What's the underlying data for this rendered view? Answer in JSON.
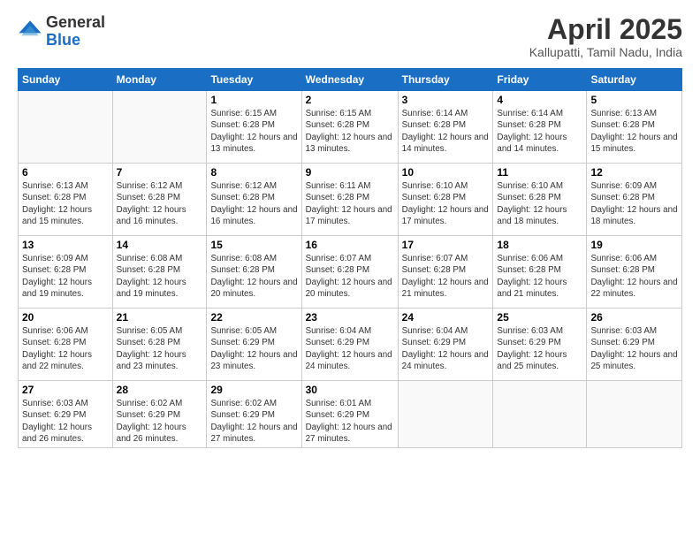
{
  "header": {
    "logo_general": "General",
    "logo_blue": "Blue",
    "month_title": "April 2025",
    "location": "Kallupatti, Tamil Nadu, India"
  },
  "days_of_week": [
    "Sunday",
    "Monday",
    "Tuesday",
    "Wednesday",
    "Thursday",
    "Friday",
    "Saturday"
  ],
  "weeks": [
    [
      {
        "num": "",
        "sunrise": "",
        "sunset": "",
        "daylight": ""
      },
      {
        "num": "",
        "sunrise": "",
        "sunset": "",
        "daylight": ""
      },
      {
        "num": "1",
        "sunrise": "Sunrise: 6:15 AM",
        "sunset": "Sunset: 6:28 PM",
        "daylight": "Daylight: 12 hours and 13 minutes."
      },
      {
        "num": "2",
        "sunrise": "Sunrise: 6:15 AM",
        "sunset": "Sunset: 6:28 PM",
        "daylight": "Daylight: 12 hours and 13 minutes."
      },
      {
        "num": "3",
        "sunrise": "Sunrise: 6:14 AM",
        "sunset": "Sunset: 6:28 PM",
        "daylight": "Daylight: 12 hours and 14 minutes."
      },
      {
        "num": "4",
        "sunrise": "Sunrise: 6:14 AM",
        "sunset": "Sunset: 6:28 PM",
        "daylight": "Daylight: 12 hours and 14 minutes."
      },
      {
        "num": "5",
        "sunrise": "Sunrise: 6:13 AM",
        "sunset": "Sunset: 6:28 PM",
        "daylight": "Daylight: 12 hours and 15 minutes."
      }
    ],
    [
      {
        "num": "6",
        "sunrise": "Sunrise: 6:13 AM",
        "sunset": "Sunset: 6:28 PM",
        "daylight": "Daylight: 12 hours and 15 minutes."
      },
      {
        "num": "7",
        "sunrise": "Sunrise: 6:12 AM",
        "sunset": "Sunset: 6:28 PM",
        "daylight": "Daylight: 12 hours and 16 minutes."
      },
      {
        "num": "8",
        "sunrise": "Sunrise: 6:12 AM",
        "sunset": "Sunset: 6:28 PM",
        "daylight": "Daylight: 12 hours and 16 minutes."
      },
      {
        "num": "9",
        "sunrise": "Sunrise: 6:11 AM",
        "sunset": "Sunset: 6:28 PM",
        "daylight": "Daylight: 12 hours and 17 minutes."
      },
      {
        "num": "10",
        "sunrise": "Sunrise: 6:10 AM",
        "sunset": "Sunset: 6:28 PM",
        "daylight": "Daylight: 12 hours and 17 minutes."
      },
      {
        "num": "11",
        "sunrise": "Sunrise: 6:10 AM",
        "sunset": "Sunset: 6:28 PM",
        "daylight": "Daylight: 12 hours and 18 minutes."
      },
      {
        "num": "12",
        "sunrise": "Sunrise: 6:09 AM",
        "sunset": "Sunset: 6:28 PM",
        "daylight": "Daylight: 12 hours and 18 minutes."
      }
    ],
    [
      {
        "num": "13",
        "sunrise": "Sunrise: 6:09 AM",
        "sunset": "Sunset: 6:28 PM",
        "daylight": "Daylight: 12 hours and 19 minutes."
      },
      {
        "num": "14",
        "sunrise": "Sunrise: 6:08 AM",
        "sunset": "Sunset: 6:28 PM",
        "daylight": "Daylight: 12 hours and 19 minutes."
      },
      {
        "num": "15",
        "sunrise": "Sunrise: 6:08 AM",
        "sunset": "Sunset: 6:28 PM",
        "daylight": "Daylight: 12 hours and 20 minutes."
      },
      {
        "num": "16",
        "sunrise": "Sunrise: 6:07 AM",
        "sunset": "Sunset: 6:28 PM",
        "daylight": "Daylight: 12 hours and 20 minutes."
      },
      {
        "num": "17",
        "sunrise": "Sunrise: 6:07 AM",
        "sunset": "Sunset: 6:28 PM",
        "daylight": "Daylight: 12 hours and 21 minutes."
      },
      {
        "num": "18",
        "sunrise": "Sunrise: 6:06 AM",
        "sunset": "Sunset: 6:28 PM",
        "daylight": "Daylight: 12 hours and 21 minutes."
      },
      {
        "num": "19",
        "sunrise": "Sunrise: 6:06 AM",
        "sunset": "Sunset: 6:28 PM",
        "daylight": "Daylight: 12 hours and 22 minutes."
      }
    ],
    [
      {
        "num": "20",
        "sunrise": "Sunrise: 6:06 AM",
        "sunset": "Sunset: 6:28 PM",
        "daylight": "Daylight: 12 hours and 22 minutes."
      },
      {
        "num": "21",
        "sunrise": "Sunrise: 6:05 AM",
        "sunset": "Sunset: 6:28 PM",
        "daylight": "Daylight: 12 hours and 23 minutes."
      },
      {
        "num": "22",
        "sunrise": "Sunrise: 6:05 AM",
        "sunset": "Sunset: 6:29 PM",
        "daylight": "Daylight: 12 hours and 23 minutes."
      },
      {
        "num": "23",
        "sunrise": "Sunrise: 6:04 AM",
        "sunset": "Sunset: 6:29 PM",
        "daylight": "Daylight: 12 hours and 24 minutes."
      },
      {
        "num": "24",
        "sunrise": "Sunrise: 6:04 AM",
        "sunset": "Sunset: 6:29 PM",
        "daylight": "Daylight: 12 hours and 24 minutes."
      },
      {
        "num": "25",
        "sunrise": "Sunrise: 6:03 AM",
        "sunset": "Sunset: 6:29 PM",
        "daylight": "Daylight: 12 hours and 25 minutes."
      },
      {
        "num": "26",
        "sunrise": "Sunrise: 6:03 AM",
        "sunset": "Sunset: 6:29 PM",
        "daylight": "Daylight: 12 hours and 25 minutes."
      }
    ],
    [
      {
        "num": "27",
        "sunrise": "Sunrise: 6:03 AM",
        "sunset": "Sunset: 6:29 PM",
        "daylight": "Daylight: 12 hours and 26 minutes."
      },
      {
        "num": "28",
        "sunrise": "Sunrise: 6:02 AM",
        "sunset": "Sunset: 6:29 PM",
        "daylight": "Daylight: 12 hours and 26 minutes."
      },
      {
        "num": "29",
        "sunrise": "Sunrise: 6:02 AM",
        "sunset": "Sunset: 6:29 PM",
        "daylight": "Daylight: 12 hours and 27 minutes."
      },
      {
        "num": "30",
        "sunrise": "Sunrise: 6:01 AM",
        "sunset": "Sunset: 6:29 PM",
        "daylight": "Daylight: 12 hours and 27 minutes."
      },
      {
        "num": "",
        "sunrise": "",
        "sunset": "",
        "daylight": ""
      },
      {
        "num": "",
        "sunrise": "",
        "sunset": "",
        "daylight": ""
      },
      {
        "num": "",
        "sunrise": "",
        "sunset": "",
        "daylight": ""
      }
    ]
  ]
}
